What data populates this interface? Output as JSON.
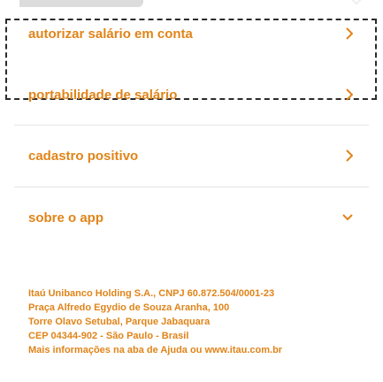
{
  "menu": {
    "items": [
      {
        "label": "autorizar salário em conta",
        "icon": "chevron-right-icon"
      },
      {
        "label": "portabilidade de salário",
        "icon": "chevron-right-icon"
      },
      {
        "label": "cadastro positivo",
        "icon": "chevron-right-icon"
      },
      {
        "label": "sobre o app",
        "icon": "chevron-down-icon"
      }
    ]
  },
  "footer": {
    "lines": [
      "Itaú Unibanco Holding S.A., CNPJ 60.872.504/0001-23",
      "Praça Alfredo Egydio de Souza Aranha, 100",
      "Torre Olavo Setubal, Parque Jabaquara",
      "CEP 04344-902 - São Paulo - Brasil",
      "Mais informações na aba de Ajuda ou www.itau.com.br"
    ]
  },
  "colors": {
    "accent": "#e08419",
    "divider": "#e4e4e4"
  }
}
